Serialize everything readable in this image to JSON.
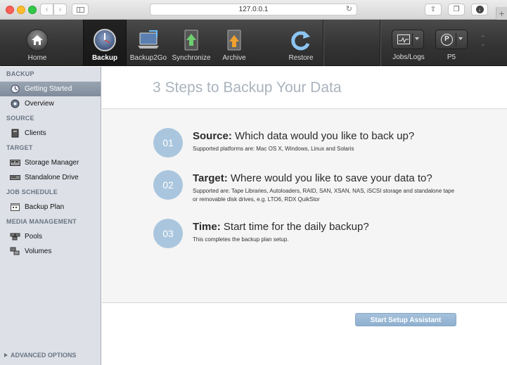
{
  "browser": {
    "url": "127.0.0.1",
    "new_tab": "+"
  },
  "toolbar": {
    "items": [
      {
        "label": "Home",
        "icon": "home-icon"
      },
      {
        "label": "Backup",
        "icon": "backup-clock-icon",
        "active": true
      },
      {
        "label": "Backup2Go",
        "icon": "laptop-icon"
      },
      {
        "label": "Synchronize",
        "icon": "synchronize-icon"
      },
      {
        "label": "Archive",
        "icon": "archive-icon"
      },
      {
        "label": "Restore",
        "icon": "restore-icon"
      }
    ],
    "jobs_logs_label": "Jobs/Logs",
    "p5_label": "P5",
    "p5_badge": "P"
  },
  "sidebar": {
    "sections": [
      {
        "title": "BACKUP",
        "items": [
          {
            "label": "Getting Started",
            "icon": "getting-started-icon",
            "selected": true
          },
          {
            "label": "Overview",
            "icon": "overview-icon"
          }
        ]
      },
      {
        "title": "SOURCE",
        "items": [
          {
            "label": "Clients",
            "icon": "clients-icon"
          }
        ]
      },
      {
        "title": "TARGET",
        "items": [
          {
            "label": "Storage Manager",
            "icon": "storage-manager-icon"
          },
          {
            "label": "Standalone Drive",
            "icon": "standalone-drive-icon"
          }
        ]
      },
      {
        "title": "JOB SCHEDULE",
        "items": [
          {
            "label": "Backup Plan",
            "icon": "backup-plan-icon"
          }
        ]
      },
      {
        "title": "MEDIA MANAGEMENT",
        "items": [
          {
            "label": "Pools",
            "icon": "pools-icon"
          },
          {
            "label": "Volumes",
            "icon": "volumes-icon"
          }
        ]
      }
    ],
    "advanced_options": "ADVANCED OPTIONS"
  },
  "main": {
    "title": "3 Steps to Backup Your Data",
    "steps": [
      {
        "number": "01",
        "title_bold": "Source:",
        "title_rest": " Which data would you like to back up?",
        "desc": "Supported platforms are: Mac OS X, Windows, Linux and Solaris"
      },
      {
        "number": "02",
        "title_bold": "Target:",
        "title_rest": " Where would you like to save your data to?",
        "desc": "Supported are: Tape Libraries, Autoloaders, RAID, SAN, XSAN, NAS, iSCSI storage and standalone tape or removable disk drives, e.g. LTO6, RDX QuikStor"
      },
      {
        "number": "03",
        "title_bold": "Time:",
        "title_rest": " Start time for the daily backup?",
        "desc": "This completes the backup plan setup."
      }
    ],
    "setup_button": "Start Setup Assistant"
  },
  "colors": {
    "accent": "#aac6de",
    "button": "#8fb0cf",
    "sidebar_bg": "#dde1e7",
    "toolbar_bg": "#333333"
  }
}
